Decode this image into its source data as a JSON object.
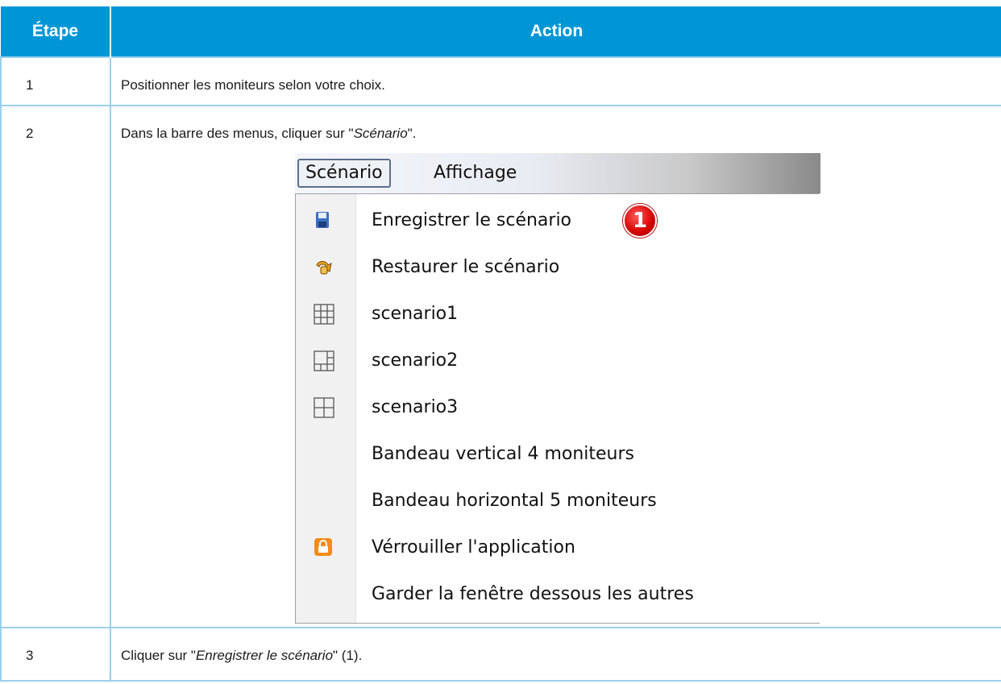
{
  "table": {
    "headers": [
      "Étape",
      "Action"
    ],
    "rows": [
      {
        "step": "1",
        "action_pre": "Positionner les moniteurs selon votre choix.",
        "action_em": "",
        "action_post": ""
      },
      {
        "step": "2",
        "action_pre": "Dans la barre des menus, cliquer sur \"",
        "action_em": "Scénario",
        "action_post": "\"."
      },
      {
        "step": "3",
        "action_pre": "Cliquer sur \"",
        "action_em": "Enregistrer le scénario",
        "action_post": "\" (1)."
      }
    ]
  },
  "menu_screenshot": {
    "menubar": [
      "Scénario",
      "Affichage"
    ],
    "items": [
      {
        "label": "Enregistrer le scénario",
        "icon": "save-icon"
      },
      {
        "label": "Restaurer le scénario",
        "icon": "restore-icon"
      },
      {
        "label": "scenario1",
        "icon": "grid-3x3-icon"
      },
      {
        "label": "scenario2",
        "icon": "grid-layout-2-icon"
      },
      {
        "label": "scenario3",
        "icon": "grid-2x2-icon"
      },
      {
        "label": "Bandeau vertical 4 moniteurs",
        "icon": ""
      },
      {
        "label": "Bandeau horizontal 5 moniteurs",
        "icon": ""
      },
      {
        "label": "Vérrouiller l'application",
        "icon": "lock-icon"
      },
      {
        "label": "Garder la fenêtre dessous les autres",
        "icon": ""
      }
    ],
    "callout": "1"
  }
}
